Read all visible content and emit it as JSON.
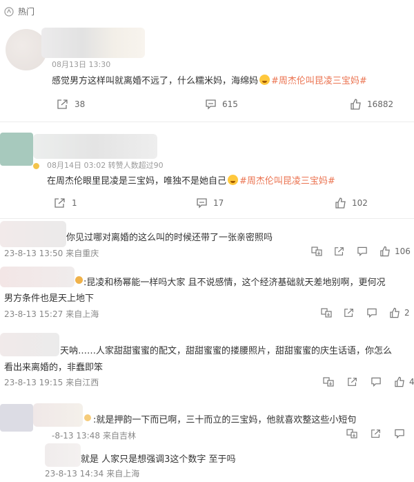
{
  "header": {
    "title": "热门"
  },
  "comments": [
    {
      "meta": "08月13日 13:30",
      "text": "感觉男方这样叫就离婚不远了，什么糯米妈，海绵妈",
      "hashtag": "#周杰伦叫昆凌三宝妈#",
      "share": "38",
      "comments": "615",
      "likes": "16882"
    },
    {
      "meta": "08月14日 03:02 转赞人数超过90",
      "text": "在周杰伦眼里昆凌是三宝妈，唯独不是她自己",
      "hashtag": "#周杰伦叫昆凌三宝妈#",
      "share": "1",
      "comments": "17",
      "likes": "102"
    }
  ],
  "replies": [
    {
      "text": "你见过哪对离婚的这么叫的时候还带了一张亲密照吗",
      "time": "23-8-13 13:50",
      "source": "来自重庆",
      "likes": "106"
    },
    {
      "text1": ":昆凌和杨幂能一样吗大家 且不说感情，这个经济基础就天差地别啊，更何况",
      "text2": "男方条件也是天上地下",
      "time": "23-8-13 15:27",
      "source": "来自上海",
      "likes": "2"
    },
    {
      "text1": "天呐……人家甜甜蜜蜜的配文，甜甜蜜蜜的搂腰照片，甜甜蜜蜜的庆生话语，你怎么",
      "text2": "看出来离婚的，非蠢即笨",
      "time": "23-8-13 19:15",
      "source": "来自江西",
      "likes": "4"
    },
    {
      "text": ":就是押韵一下而已啊，三十而立的三宝妈，他就喜欢整这些小短句",
      "time": "-8-13 13:48",
      "source": "来自吉林"
    },
    {
      "text": "就是 人家只是想强调3这个数字 至于吗",
      "time": "23-8-13 14:34",
      "source": "来自上海"
    }
  ]
}
